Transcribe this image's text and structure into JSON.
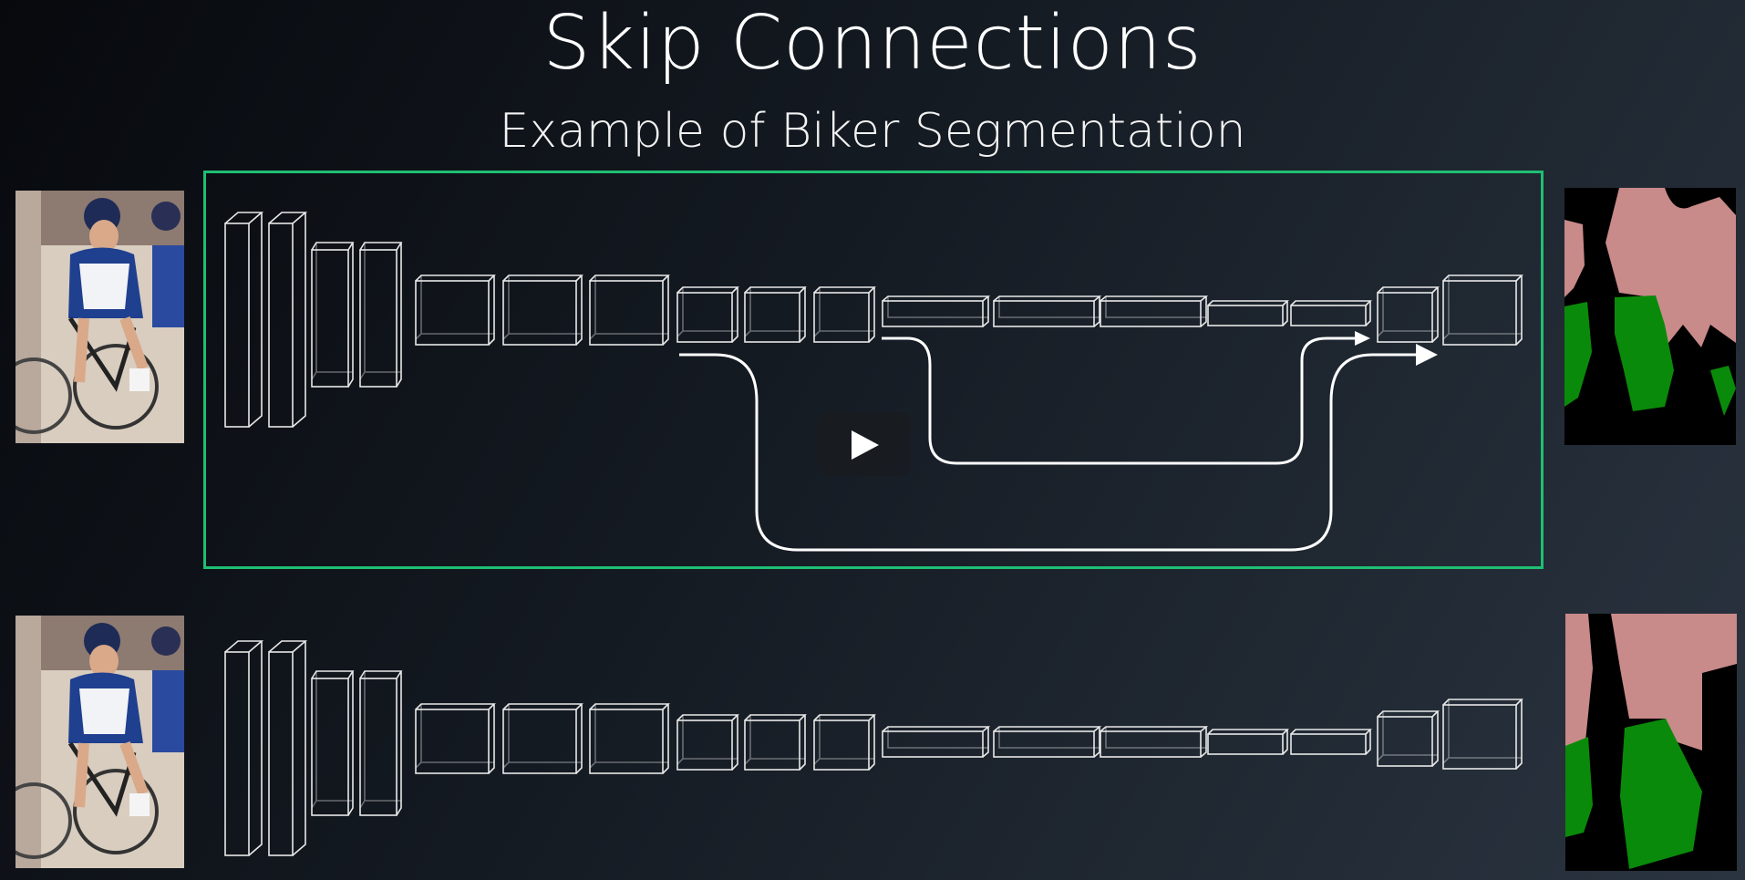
{
  "header": {
    "title": "Skip Connections",
    "subtitle": "Example of Biker Segmentation"
  },
  "colors": {
    "highlight_border": "#1fbf73",
    "mask_person": "#c98a8a",
    "mask_bike": "#0a8a0a",
    "mask_background": "#000000",
    "block_stroke": "#e8e8e8",
    "arrow": "#ffffff"
  },
  "player": {
    "play_icon": "play-icon"
  }
}
